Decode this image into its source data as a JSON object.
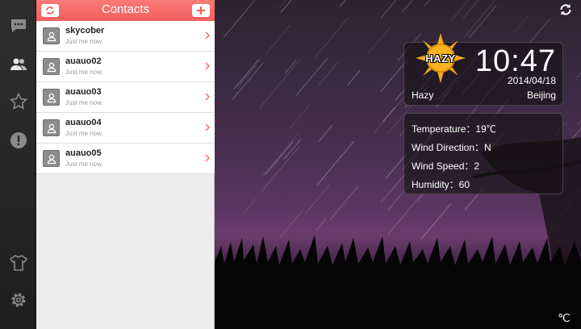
{
  "rail": {
    "items": [
      {
        "name": "rail-chat",
        "icon": "chat-bubble-icon"
      },
      {
        "name": "rail-contacts",
        "icon": "contacts-icon"
      },
      {
        "name": "rail-favorites",
        "icon": "star-icon"
      },
      {
        "name": "rail-alerts",
        "icon": "alert-icon"
      },
      {
        "name": "rail-theme",
        "icon": "shirt-icon"
      },
      {
        "name": "rail-settings",
        "icon": "gear-icon"
      }
    ]
  },
  "contacts": {
    "title": "Contacts",
    "refresh_icon": "refresh-icon",
    "add_icon": "plus-icon",
    "list": [
      {
        "name": "skycober",
        "status": "Just me now."
      },
      {
        "name": "auauo02",
        "status": "Just me now."
      },
      {
        "name": "auauo03",
        "status": "Just me now."
      },
      {
        "name": "auauo04",
        "status": "Just me now."
      },
      {
        "name": "auauo05",
        "status": "Just me now."
      }
    ]
  },
  "weather": {
    "badge": "HAZY",
    "time": "10:47",
    "date": "2014/04/18",
    "condition": "Hazy",
    "city": "Beijing",
    "details": {
      "temperature": "Temperature：19℃",
      "wind_direction": "Wind Direction：N",
      "wind_speed": "Wind Speed：2",
      "humidity": "Humidity：60"
    },
    "unit": "℃",
    "refresh_icon": "refresh-icon"
  },
  "colors": {
    "accent": "#f56563",
    "rail": "#262626",
    "sun": "#f5a623"
  }
}
